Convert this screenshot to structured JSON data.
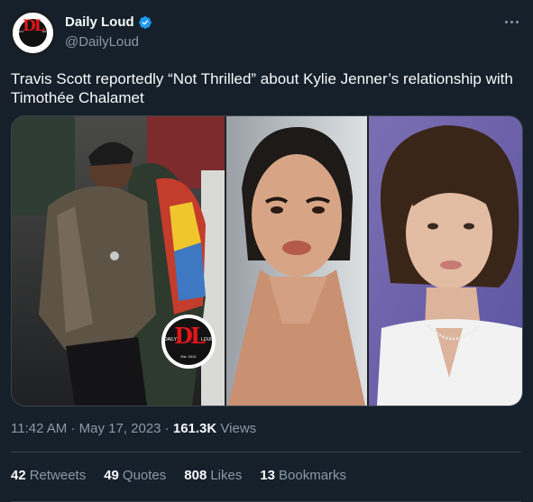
{
  "author": {
    "display_name": "Daily Loud",
    "handle": "@DailyLoud",
    "avatar_logo_text": "DL",
    "avatar_logo_left": "DAILY",
    "avatar_logo_right": "LOUD",
    "verified_color": "#1d9bf0"
  },
  "tweet": {
    "text": "Travis Scott reportedly “Not Thrilled” about Kylie Jenner’s relationship with Timothée Chalamet",
    "time": "11:42 AM",
    "date": "May 17, 2023",
    "views_count": "161.3K",
    "views_label": "Views"
  },
  "media": {
    "watermark_logo_text": "DL",
    "watermark_left": "DAILY",
    "watermark_right": "LOUD",
    "watermark_est": "Est. 2012"
  },
  "stats": [
    {
      "count": "42",
      "label": "Retweets"
    },
    {
      "count": "49",
      "label": "Quotes"
    },
    {
      "count": "808",
      "label": "Likes"
    },
    {
      "count": "13",
      "label": "Bookmarks"
    }
  ],
  "colors": {
    "background": "#15202b",
    "text_primary": "#f7f9f9",
    "text_secondary": "#8b98a5",
    "divider": "#38444d",
    "logo_red": "#e0161a"
  },
  "icons": {
    "verified": "verified-badge-icon",
    "more": "more-options-icon"
  }
}
